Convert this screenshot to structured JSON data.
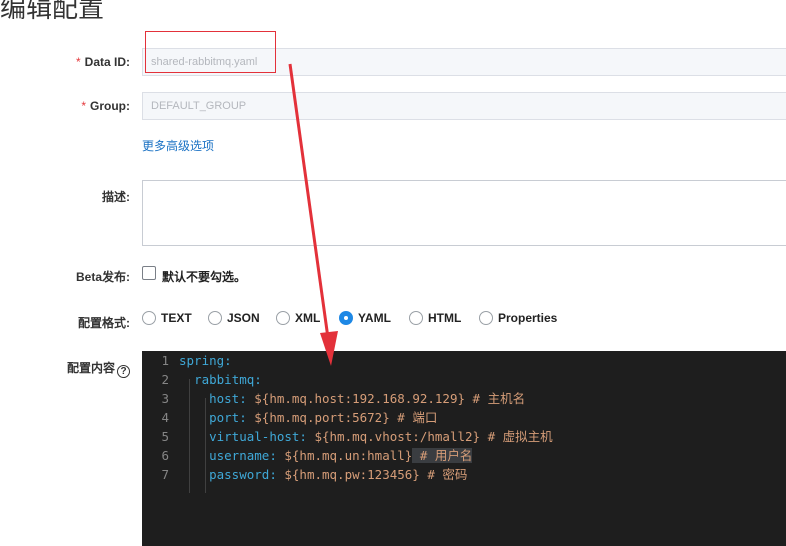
{
  "page": {
    "title": "编辑配置"
  },
  "form": {
    "data_id": {
      "label": "Data ID:",
      "required_mark": "*",
      "value": "shared-rabbitmq.yaml"
    },
    "group": {
      "label": "Group:",
      "required_mark": "*",
      "value": "DEFAULT_GROUP"
    },
    "advanced_link": "更多高级选项",
    "description": {
      "label": "描述:",
      "value": ""
    },
    "beta": {
      "label": "Beta发布:",
      "checkbox_label": "默认不要勾选。",
      "checked": false
    },
    "format": {
      "label": "配置格式:",
      "options": [
        "TEXT",
        "JSON",
        "XML",
        "YAML",
        "HTML",
        "Properties"
      ],
      "selected": "YAML"
    },
    "content": {
      "label": "配置内容",
      "help_icon": "question-circle-icon"
    }
  },
  "editor": {
    "lines": [
      {
        "num": "1",
        "indent": "",
        "key": "spring:",
        "value": "",
        "comment": ""
      },
      {
        "num": "2",
        "indent": "  ",
        "key": "rabbitmq:",
        "value": "",
        "comment": ""
      },
      {
        "num": "3",
        "indent": "    ",
        "key": "host:",
        "value": " ${hm.mq.host:192.168.92.129}",
        "comment": " # 主机名"
      },
      {
        "num": "4",
        "indent": "    ",
        "key": "port:",
        "value": " ${hm.mq.port:5672}",
        "comment": " # 端口"
      },
      {
        "num": "5",
        "indent": "    ",
        "key": "virtual-host:",
        "value": " ${hm.mq.vhost:/hmall2}",
        "comment": " # 虚拟主机"
      },
      {
        "num": "6",
        "indent": "    ",
        "key": "username:",
        "value": " ${hm.mq.un:hmall}",
        "comment": " # 用户名"
      },
      {
        "num": "7",
        "indent": "    ",
        "key": "password:",
        "value": " ${hm.mq.pw:123456}",
        "comment": " # 密码"
      }
    ]
  },
  "colors": {
    "annotation": "#e3313a",
    "radio_accent": "#1e88e5",
    "link": "#1b72c4"
  }
}
